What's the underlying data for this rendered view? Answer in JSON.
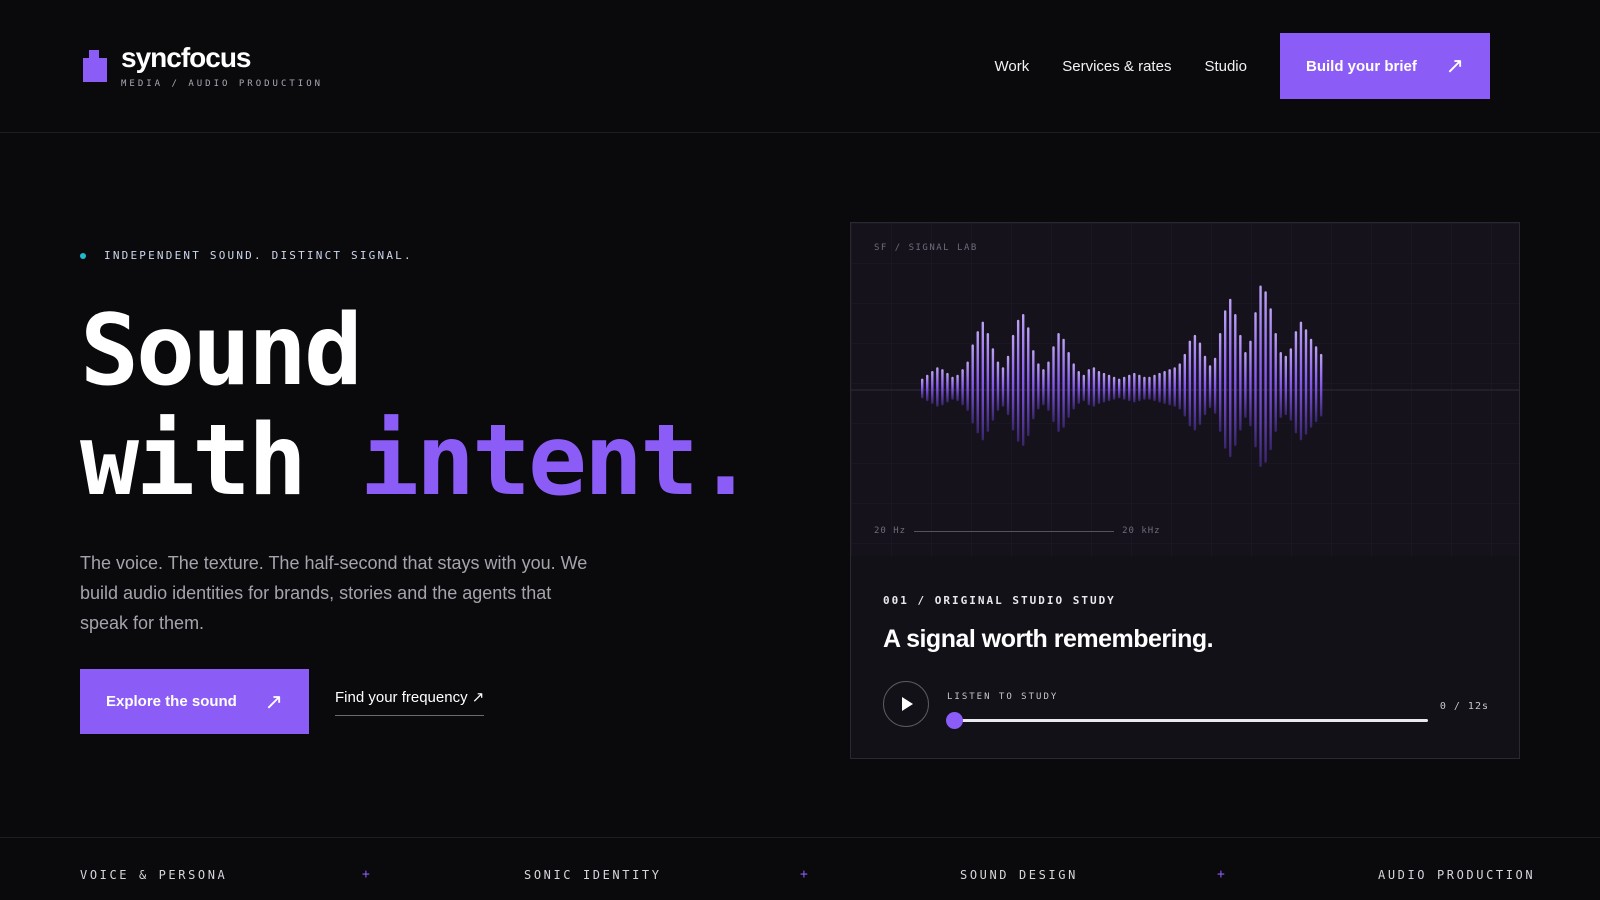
{
  "brand": {
    "name": "syncfocus",
    "tagline": "MEDIA / AUDIO PRODUCTION",
    "accent": "#8b5cf6",
    "signal_dot": "#22b8cf"
  },
  "nav": {
    "links": [
      "Work",
      "Services & rates",
      "Studio"
    ],
    "cta": {
      "label": "Build your brief",
      "icon": "arrow-up-right-icon"
    }
  },
  "hero": {
    "eyebrow": "INDEPENDENT SOUND. DISTINCT SIGNAL.",
    "title_line1": "Sound",
    "title_line2_a": "with ",
    "title_line2_b": "intent.",
    "lede": "The voice. The texture. The half-second that stays with you. We build audio identities for brands, stories and the agents that speak for them.",
    "primary_cta": "Explore the sound",
    "secondary_cta": "Find your frequency ↗"
  },
  "study_card": {
    "viz_tag": "SF / SIGNAL LAB",
    "range_low": "20 Hz",
    "range_high": "20 kHz",
    "eyebrow": "001 / ORIGINAL STUDIO STUDY",
    "title": "A signal worth remembering.",
    "player": {
      "label": "LISTEN TO STUDY",
      "time": "0 / 12s",
      "progress": 0
    }
  },
  "ticker": {
    "items": [
      "VOICE & PERSONA",
      "SONIC IDENTITY",
      "SOUND DESIGN",
      "AUDIO PRODUCTION"
    ],
    "separator": "+"
  }
}
